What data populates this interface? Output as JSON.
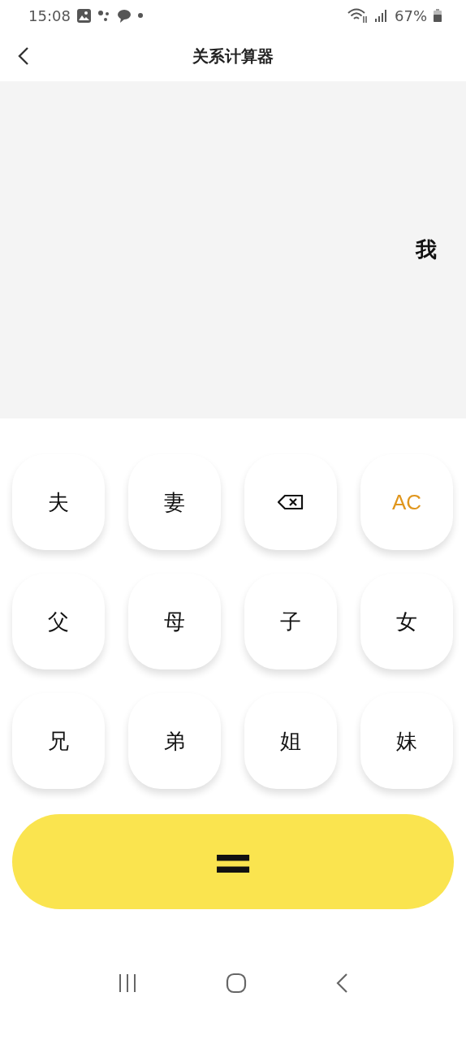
{
  "status_bar": {
    "time": "15:08",
    "battery": "67%"
  },
  "header": {
    "title": "关系计算器"
  },
  "display": {
    "text": "我"
  },
  "keys": [
    {
      "kind": "char",
      "label": "夫"
    },
    {
      "kind": "char",
      "label": "妻"
    },
    {
      "kind": "backspace"
    },
    {
      "kind": "clear",
      "label": "AC"
    },
    {
      "kind": "char",
      "label": "父"
    },
    {
      "kind": "char",
      "label": "母"
    },
    {
      "kind": "char",
      "label": "子"
    },
    {
      "kind": "char",
      "label": "女"
    },
    {
      "kind": "char",
      "label": "兄"
    },
    {
      "kind": "char",
      "label": "弟"
    },
    {
      "kind": "char",
      "label": "姐"
    },
    {
      "kind": "char",
      "label": "妹"
    }
  ],
  "equals": {
    "label": "="
  }
}
